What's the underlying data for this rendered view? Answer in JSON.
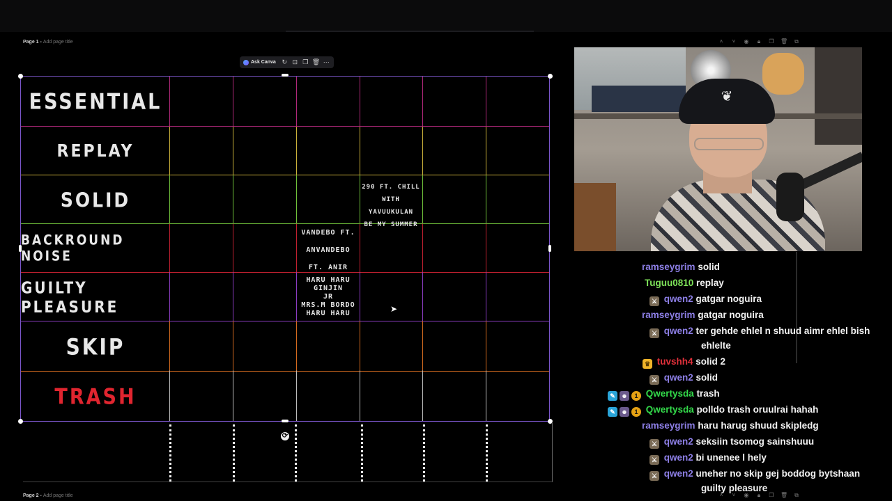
{
  "editor": {
    "page1": {
      "label": "Page 1",
      "sep": " - ",
      "subtitle": "Add page title"
    },
    "page2": {
      "label": "Page 2",
      "sep": " - ",
      "subtitle": "Add page title"
    },
    "toolbar": {
      "ask_canva_label": "Ask Canva"
    }
  },
  "tier_list": {
    "tiers": [
      {
        "label": "ESSENTIAL",
        "color": "#e8e8e8",
        "line_color": "#b0287a"
      },
      {
        "label": "REPLAY",
        "color": "#e8e8e8",
        "line_color": "#c9b03a"
      },
      {
        "label": "SOLID",
        "color": "#e8e8e8",
        "line_color": "#6fbf3a"
      },
      {
        "label": "BACKROUND NOISE",
        "color": "#e8e8e8",
        "line_color": "#c02030"
      },
      {
        "label": "GUILTY PLEASURE",
        "color": "#e8e8e8",
        "line_color": "#8a3cc0"
      },
      {
        "label": "SKIP",
        "color": "#e8e8e8",
        "line_color": "#d36a1f"
      },
      {
        "label": "TRASH",
        "color": "#e0252f",
        "line_color": "#bbbbbb"
      }
    ],
    "songs": {
      "solid_song": [
        "290 FT. CHILL",
        "WITH YAVUUKULAN",
        "BE MY SUMMER"
      ],
      "noise_song": [
        "VANDEBO FT.",
        "ANVANDEBO",
        "FT. ANIR"
      ],
      "guilty_song": [
        "HARU HARU",
        "GINJIN",
        "JR",
        "MRS.M BORDO",
        "HARU HARU"
      ]
    }
  },
  "chat": {
    "messages": [
      {
        "user": "ramseygrim",
        "color": "#8d7fe6",
        "text": "solid",
        "badges": []
      },
      {
        "user": "Tuguu0810",
        "color": "#7fe45a",
        "text": "replay",
        "badges": []
      },
      {
        "user": "qwen2",
        "color": "#8d7fe6",
        "text": "gatgar noguira",
        "badges": [
          "mod"
        ]
      },
      {
        "user": "ramseygrim",
        "color": "#8d7fe6",
        "text": "gatgar noguira",
        "badges": []
      },
      {
        "user": "qwen2",
        "color": "#8d7fe6",
        "text": "ter gehde ehlel n shuud aimr ehlel bish",
        "text2": "ehlelte",
        "badges": [
          "mod"
        ]
      },
      {
        "user": "tuvshh4",
        "color": "#e0303a",
        "text": "solid 2",
        "badges": [
          "crown"
        ]
      },
      {
        "user": "qwen2",
        "color": "#8d7fe6",
        "text": "solid",
        "badges": [
          "mod"
        ]
      },
      {
        "user": "Qwertysda",
        "color": "#33d94a",
        "text": "trash",
        "badges": [
          "pen",
          "purple",
          "gold"
        ]
      },
      {
        "user": "Qwertysda",
        "color": "#33d94a",
        "text": "polldo trash oruulrai hahah",
        "badges": [
          "pen",
          "purple",
          "gold"
        ]
      },
      {
        "user": "ramseygrim",
        "color": "#8d7fe6",
        "text": "haru harug shuud skipledg",
        "badges": []
      },
      {
        "user": "qwen2",
        "color": "#8d7fe6",
        "text": "seksiin tsomog sainshuuu",
        "badges": [
          "mod"
        ]
      },
      {
        "user": "qwen2",
        "color": "#8d7fe6",
        "text": "bi unenee l hely",
        "badges": [
          "mod"
        ]
      },
      {
        "user": "qwen2",
        "color": "#8d7fe6",
        "text": "uneher no skip gej boddog bytshaan",
        "text2": "guilty pleasure",
        "badges": [
          "mod"
        ]
      }
    ]
  }
}
